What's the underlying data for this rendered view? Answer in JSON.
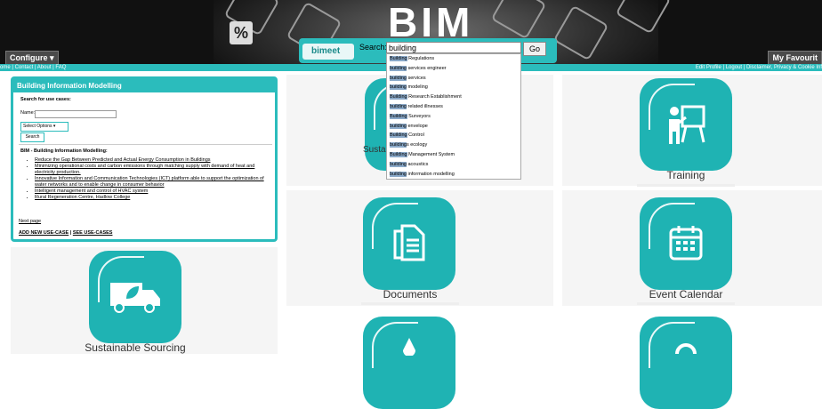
{
  "header": {
    "brand_title": "BIM",
    "configure_label": "Configure ▾",
    "favourites_label": "My Favourit",
    "percent_glyph": "%"
  },
  "search": {
    "logo_text": "bimeet",
    "label": "Search:",
    "value": "building",
    "go_label": "Go"
  },
  "nav": {
    "left_links": "ome | Contact | About | FAQ",
    "right_links": "Edit Profile | Logout | Disclaimer, Privacy & Cookie Inf"
  },
  "autocomplete": {
    "prefix": "building",
    "items": [
      {
        "hl": "Building",
        "rest": " Regulations"
      },
      {
        "hl": "building",
        "rest": " services engineer"
      },
      {
        "hl": "building",
        "rest": " services"
      },
      {
        "hl": "building",
        "rest": " modeling"
      },
      {
        "hl": "Building",
        "rest": " Research Establishment"
      },
      {
        "hl": "building",
        "rest": " related illnesses"
      },
      {
        "hl": "Building",
        "rest": " Surveyors"
      },
      {
        "hl": "building",
        "rest": " envelope"
      },
      {
        "hl": "Building",
        "rest": " Control"
      },
      {
        "hl": "building",
        "rest": "s ecology"
      },
      {
        "hl": "Building",
        "rest": " Management System"
      },
      {
        "hl": "building",
        "rest": " acoustics"
      },
      {
        "hl": "building",
        "rest": " information modelling"
      }
    ]
  },
  "panel": {
    "title": "Building Information Modelling",
    "search_heading": "Search for use cases:",
    "name_label": "Name:",
    "select_label": "Select Options ▾",
    "search_button": "Search",
    "list_heading": "BIM - Building Information Modelling:",
    "use_cases": [
      "Reduce the Gap Between Predicted and Actual Energy Consumption in Buildings",
      "Minimizing operational costs and carbon emissions through matching supply with demand of heat and electricity production.",
      "Innovative Information and Communication Technologies (ICT) platform able to support the optimization of water networks and to enable change in consumer behavior",
      "Intelligent management and control of HVAC system",
      "Rural Regeneration Centre, Hadlow College"
    ],
    "next_page": "Next page",
    "add_new": "ADD NEW USE-CASE",
    "separator": " | ",
    "see_cases": "SEE USE-CASES"
  },
  "tiles": {
    "sustainable_partial": "Sustai",
    "training": "Training",
    "documents": "Documents",
    "event_calendar": "Event Calendar",
    "sustainable_sourcing": "Sustainable Sourcing"
  },
  "colors": {
    "accent": "#2bbcbc",
    "tile": "#1fb3b3"
  }
}
